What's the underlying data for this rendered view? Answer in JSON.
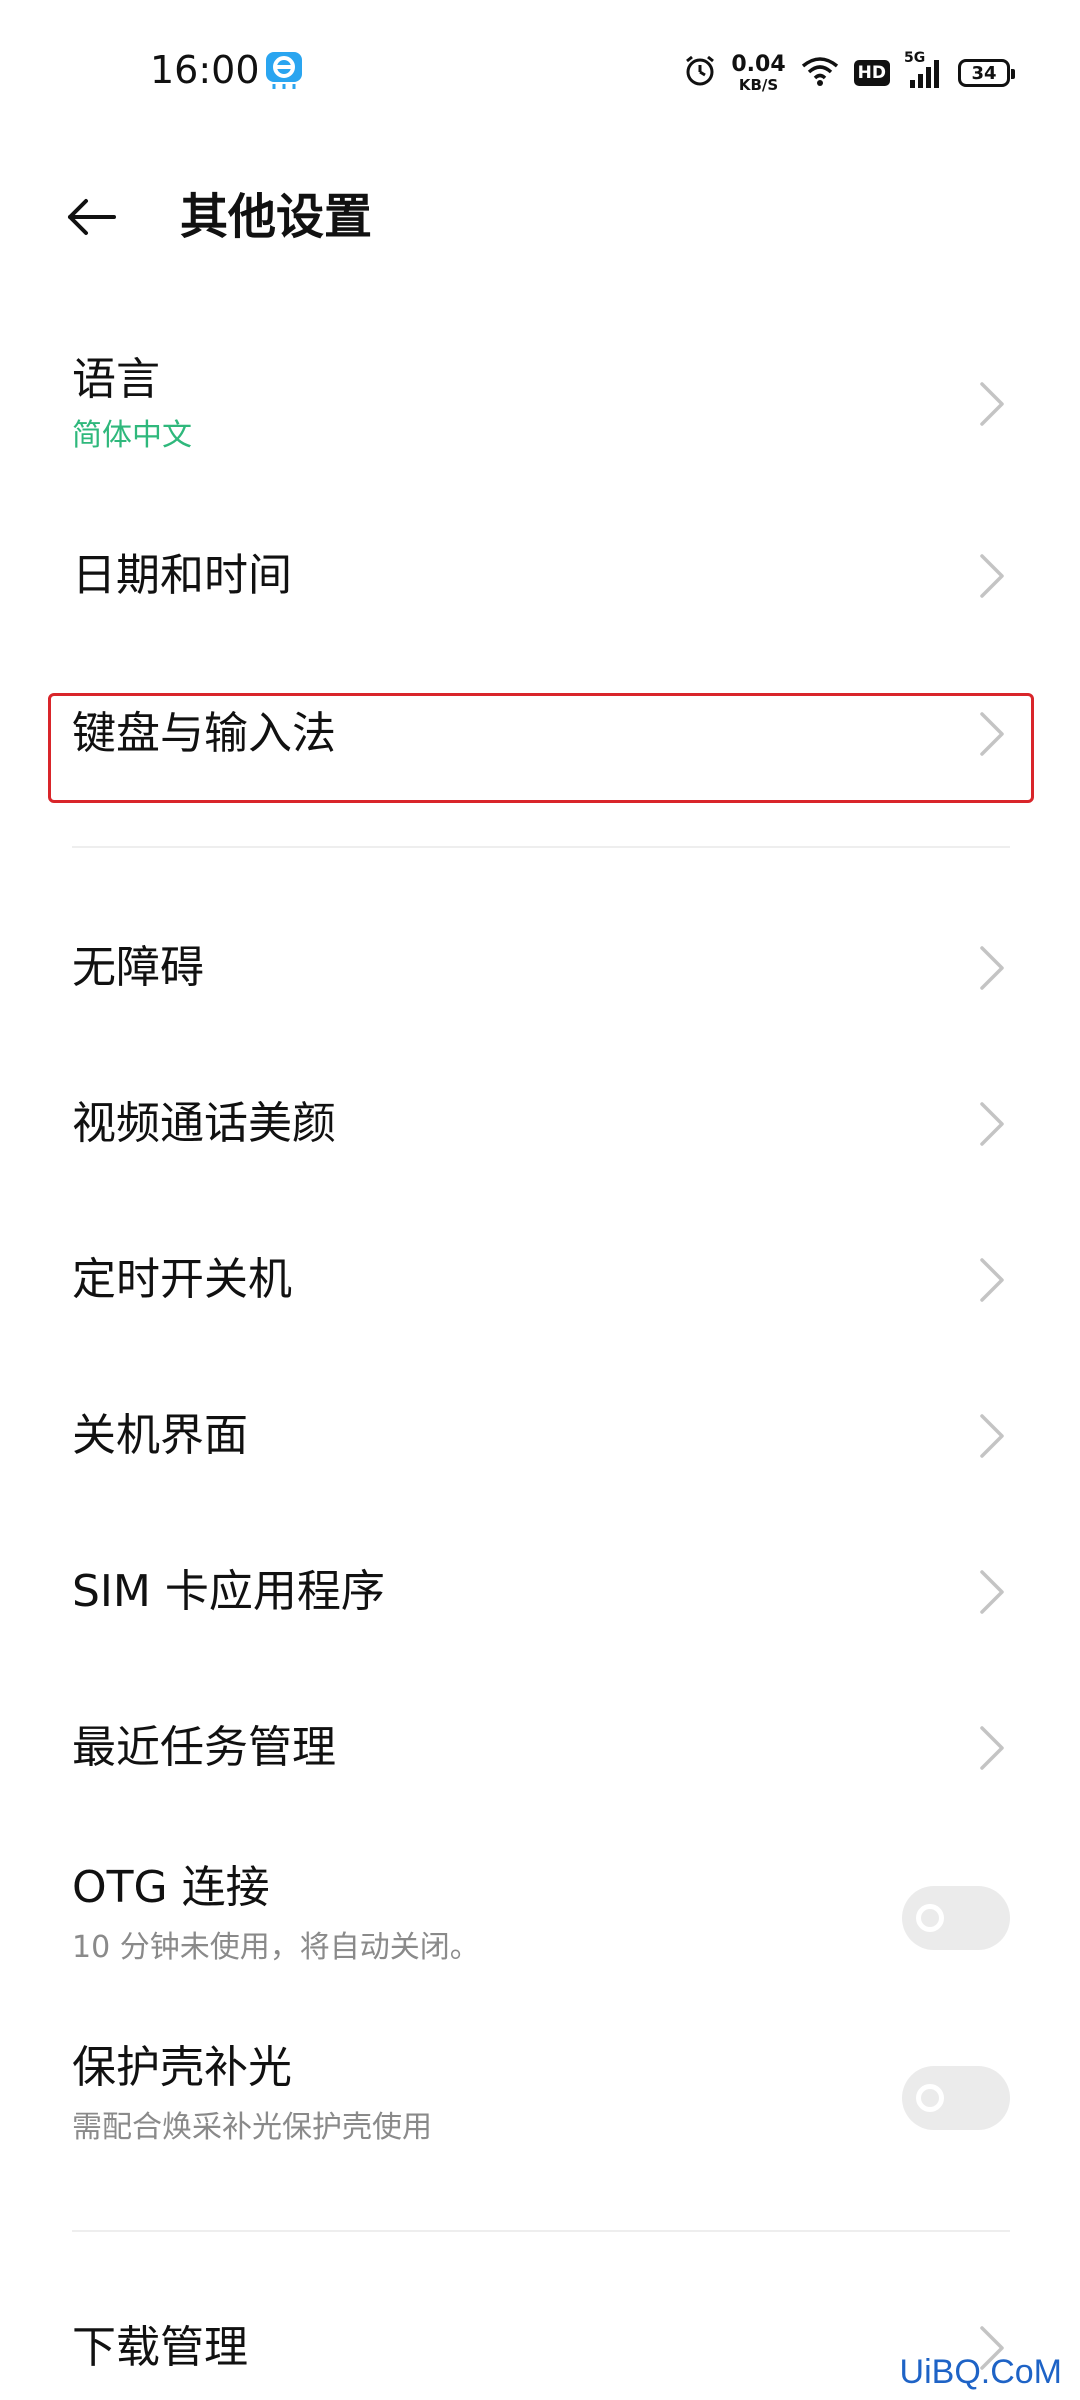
{
  "status_bar": {
    "time": "16:00",
    "net_speed_value": "0.04",
    "net_speed_unit": "KB/S",
    "hd_label": "HD",
    "network_label": "5G",
    "battery_level": "34",
    "icons": [
      "app-notification-icon",
      "alarm-icon",
      "wifi-icon",
      "signal-icon",
      "battery-icon"
    ]
  },
  "header": {
    "title": "其他设置",
    "back_icon": "arrow-left-icon"
  },
  "items": {
    "language": {
      "label": "语言",
      "sub": "简体中文"
    },
    "datetime": {
      "label": "日期和时间"
    },
    "keyboard": {
      "label": "键盘与输入法"
    },
    "accessibility": {
      "label": "无障碍"
    },
    "video_beauty": {
      "label": "视频通话美颜"
    },
    "scheduled_power": {
      "label": "定时开关机"
    },
    "shutdown_ui": {
      "label": "关机界面"
    },
    "sim_app": {
      "label": "SIM 卡应用程序"
    },
    "recent_tasks": {
      "label": "最近任务管理"
    },
    "otg": {
      "label": "OTG 连接",
      "sub": "10 分钟未使用，将自动关闭。",
      "enabled": false
    },
    "case_light": {
      "label": "保护壳补光",
      "sub": "需配合焕采补光保护壳使用",
      "enabled": false
    },
    "downloads": {
      "label": "下载管理"
    }
  },
  "colors": {
    "accent_green": "#2fb87c",
    "highlight_red": "#d9252a",
    "watermark_blue": "#1e63c6"
  },
  "watermark": "UiBQ.CoM"
}
